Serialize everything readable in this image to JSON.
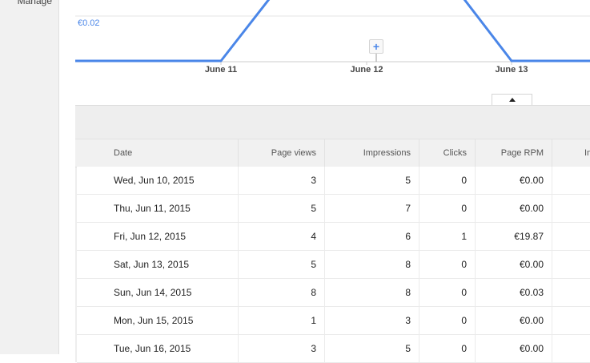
{
  "sidebar": {
    "partial_label": "Manage"
  },
  "chart": {
    "y_tick_label": "€0.02",
    "x_ticks": [
      "June 11",
      "June 12",
      "June 13"
    ],
    "line_color": "#4a86e8",
    "annotation_icon": "plus-icon"
  },
  "chart_data": {
    "type": "line",
    "x": [
      "Jun 10",
      "Jun 11",
      "Jun 12",
      "Jun 13",
      "Jun 14",
      "Jun 15",
      "Jun 16"
    ],
    "series": [
      {
        "values": [
          0.0,
          0.0,
          19.87,
          0.0,
          0.03,
          0.0,
          0.0
        ]
      }
    ],
    "xlabel": "",
    "ylabel": "",
    "y_tick_labels": [
      "€0.02"
    ]
  },
  "table": {
    "columns": [
      "Date",
      "Page views",
      "Impressions",
      "Clicks",
      "Page RPM",
      "Im"
    ],
    "rows": [
      [
        "Wed, Jun 10, 2015",
        "3",
        "5",
        "0",
        "€0.00"
      ],
      [
        "Thu, Jun 11, 2015",
        "5",
        "7",
        "0",
        "€0.00"
      ],
      [
        "Fri, Jun 12, 2015",
        "4",
        "6",
        "1",
        "€19.87"
      ],
      [
        "Sat, Jun 13, 2015",
        "5",
        "8",
        "0",
        "€0.00"
      ],
      [
        "Sun, Jun 14, 2015",
        "8",
        "8",
        "0",
        "€0.03"
      ],
      [
        "Mon, Jun 15, 2015",
        "1",
        "3",
        "0",
        "€0.00"
      ],
      [
        "Tue, Jun 16, 2015",
        "3",
        "5",
        "0",
        "€0.00"
      ]
    ]
  }
}
